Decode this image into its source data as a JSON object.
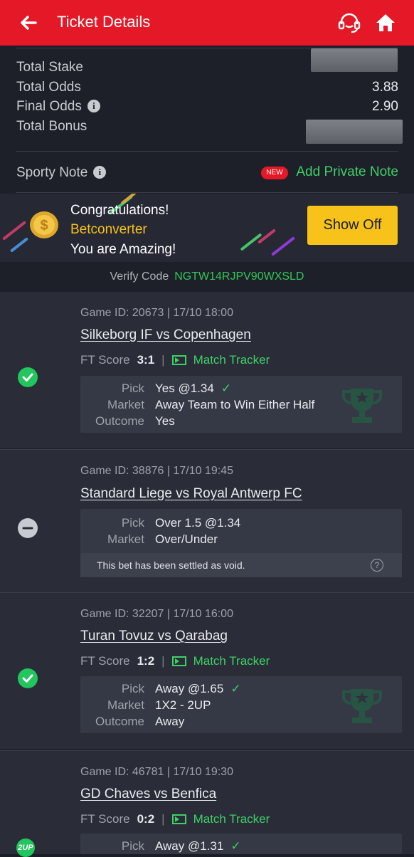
{
  "header": {
    "title": "Ticket Details",
    "back_icon": "arrow-left-icon",
    "support_icon": "headset-icon",
    "home_icon": "home-icon"
  },
  "summary": {
    "total_stake_label": "Total Stake",
    "total_odds_label": "Total Odds",
    "total_odds_value": "3.88",
    "final_odds_label": "Final Odds",
    "final_odds_value": "2.90",
    "total_bonus_label": "Total Bonus"
  },
  "note": {
    "label": "Sporty Note",
    "new_badge": "NEW",
    "add_label": "Add Private Note"
  },
  "congrats": {
    "line1": "Congratulations!",
    "name": "Betconverter",
    "line3": "You are Amazing!",
    "button": "Show Off"
  },
  "verify": {
    "label": "Verify Code",
    "code": "NGTW14RJPV90WXSLD"
  },
  "bets": [
    {
      "game": "Game ID: 20673 | 17/10 18:00",
      "match": "Silkeborg IF vs Copenhagen",
      "ft_label": "FT Score",
      "score": "3:1",
      "tracker": "Match Tracker",
      "pick_label": "Pick",
      "pick": "Yes @1.34",
      "market_label": "Market",
      "market": "Away Team to Win Either Half",
      "outcome_label": "Outcome",
      "outcome": "Yes",
      "status": "won"
    },
    {
      "game": "Game ID: 38876 | 17/10 19:45",
      "match": "Standard Liege vs Royal Antwerp FC",
      "pick_label": "Pick",
      "pick": "Over 1.5 @1.34",
      "market_label": "Market",
      "market": "Over/Under",
      "void_note": "This bet has been settled as void.",
      "status": "void"
    },
    {
      "game": "Game ID: 32207 | 17/10 16:00",
      "match": "Turan Tovuz vs Qarabag",
      "ft_label": "FT Score",
      "score": "1:2",
      "tracker": "Match Tracker",
      "pick_label": "Pick",
      "pick": "Away @1.65",
      "market_label": "Market",
      "market": "1X2 - 2UP",
      "outcome_label": "Outcome",
      "outcome": "Away",
      "status": "won"
    },
    {
      "game": "Game ID: 46781 | 17/10 19:30",
      "match": "GD Chaves vs Benfica",
      "ft_label": "FT Score",
      "score": "0:2",
      "tracker": "Match Tracker",
      "pick_label": "Pick",
      "pick": "Away @1.31",
      "badge": "2UP",
      "status": "won"
    }
  ],
  "colors": {
    "brand_red": "#e41827",
    "accent_green": "#3fd068",
    "accent_yellow": "#f7c31a"
  }
}
